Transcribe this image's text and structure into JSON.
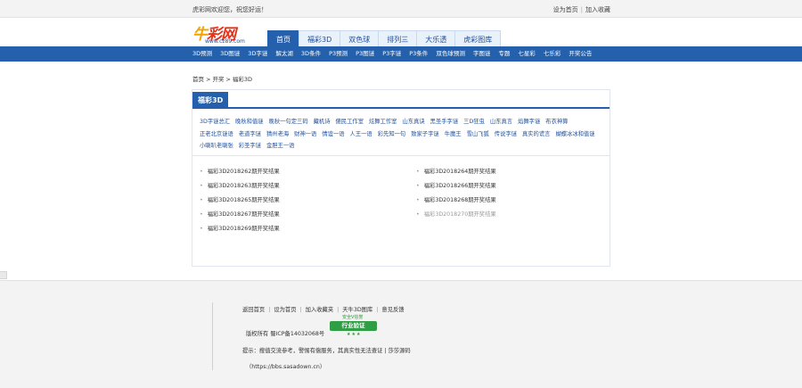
{
  "topbar": {
    "welcome": "虎彩网欢迎您，祝您好运！",
    "set_home": "设为首页",
    "add_favorite": "加入收藏"
  },
  "logo": {
    "main_a": "牛",
    "main_b": "彩网",
    "url": "www.cz89.com"
  },
  "nav_tabs": [
    {
      "label": "首页",
      "active": true
    },
    {
      "label": "福彩3D",
      "active": false
    },
    {
      "label": "双色球",
      "active": false
    },
    {
      "label": "排列三",
      "active": false
    },
    {
      "label": "大乐透",
      "active": false
    },
    {
      "label": "虎彩图库",
      "active": false
    }
  ],
  "subnav": [
    "3D预测",
    "3D图谜",
    "3D字谜",
    "解太湖",
    "3D条件",
    "P3预测",
    "P3图谜",
    "P3字谜",
    "P3条件",
    "双色球预测",
    "字图谜",
    "专题",
    "七星彩",
    "七乐彩",
    "开奖公告"
  ],
  "breadcrumb": [
    "首页",
    "开奖",
    "福彩3D"
  ],
  "panel": {
    "title": "福彩3D",
    "categories": [
      "3D字谜总汇",
      "晚秋和值谜",
      "晚秋一句定三码",
      "藏机诗",
      "傻民工作室",
      "炫舞工作室",
      "山东真诀",
      "黑圣手字谜",
      "三D狂虫",
      "山东真言",
      "焰舞字谜",
      "布衣神算",
      "正老北京谜语",
      "老道字谜",
      "猜州老海",
      "财神一语",
      "情谊一语",
      "人王一语",
      "彩先知一句",
      "致家子字谜",
      "牛魔王",
      "雪山飞狐",
      "传说字谜",
      "真实的谎言",
      "蝴蝶冰冰和值谜",
      "小喇叭老喇张",
      "彩圣字谜",
      "金胆王一语"
    ],
    "results_left": [
      "福彩3D2018262期开奖结果",
      "福彩3D2018263期开奖结果",
      "福彩3D2018265期开奖结果",
      "福彩3D2018267期开奖结果",
      "福彩3D2018269期开奖结果"
    ],
    "results_right": [
      "福彩3D2018264期开奖结果",
      "福彩3D2018266期开奖结果",
      "福彩3D2018268期开奖结果",
      "福彩3D2018270期开奖结果"
    ]
  },
  "footer": {
    "links": [
      "返回首页",
      "设为首页",
      "加入收藏夹",
      "天牛3D图库",
      "意见反馈"
    ],
    "copyright": "版权所有 蜀ICP备14032068号",
    "badge_top": "安全V信誉",
    "badge_main": "行业验证",
    "badge_stars": "★★★",
    "tip": "提示：搜值交流参考，警惕有偿服务，其真实性无法查证 | 莎莎源码",
    "site": "（https://bbs.sasadown.cn）"
  },
  "colors": {
    "brand_blue": "#2560ad",
    "logo_red": "#e8311a",
    "badge_green": "#2f9e44"
  }
}
